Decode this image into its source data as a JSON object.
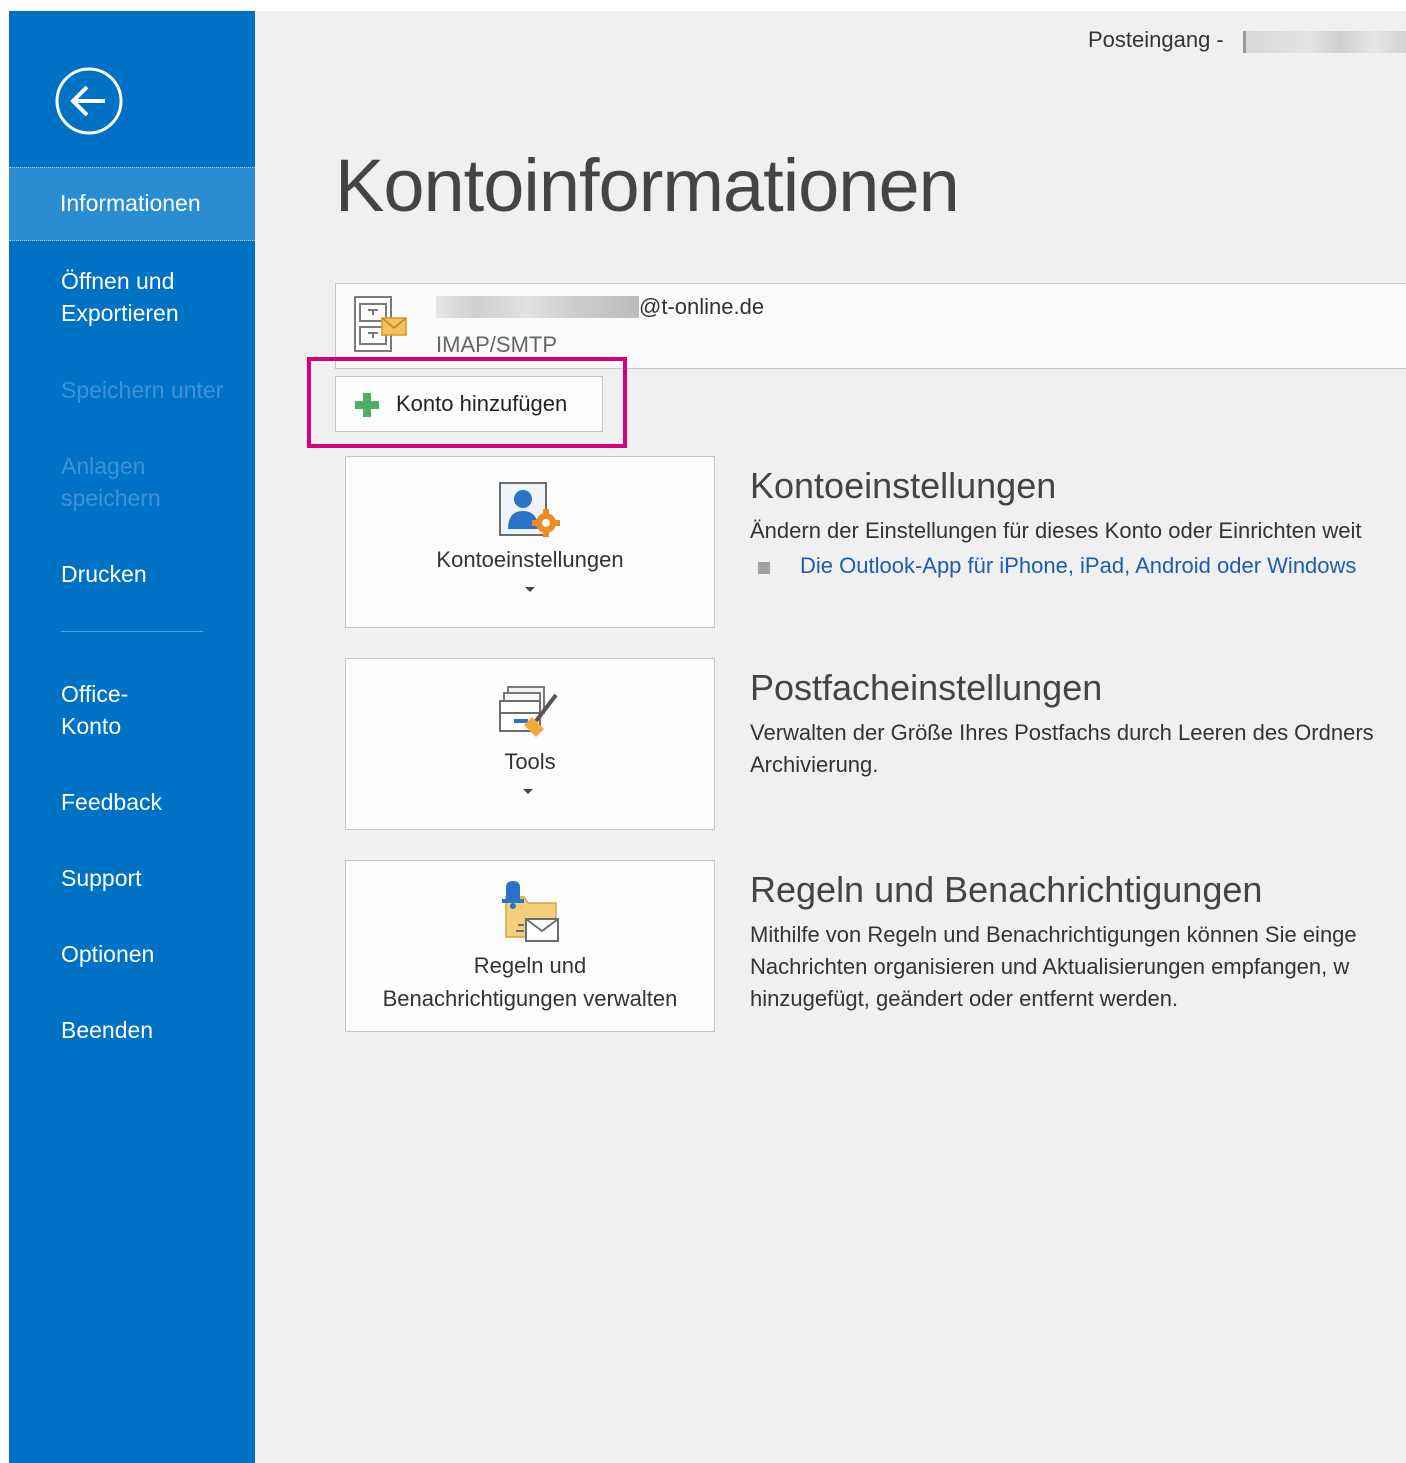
{
  "window": {
    "title": "Posteingang - "
  },
  "sidebar": {
    "items": [
      {
        "label": "Informationen",
        "state": "selected"
      },
      {
        "label": "Öffnen und\nExportieren",
        "state": "enabled"
      },
      {
        "label": "Speichern unter",
        "state": "disabled"
      },
      {
        "label": "Anlagen\nspeichern",
        "state": "disabled"
      },
      {
        "label": "Drucken",
        "state": "enabled"
      },
      {
        "label": "Office-\nKonto",
        "state": "enabled"
      },
      {
        "label": "Feedback",
        "state": "enabled"
      },
      {
        "label": "Support",
        "state": "enabled"
      },
      {
        "label": "Optionen",
        "state": "enabled"
      },
      {
        "label": "Beenden",
        "state": "enabled"
      }
    ]
  },
  "main": {
    "title": "Kontoinformationen",
    "account": {
      "email": "@t-online.de",
      "type": "IMAP/SMTP"
    },
    "add_account_label": "Konto hinzufügen",
    "sections": [
      {
        "button_label": "Kontoeinstellungen",
        "heading": "Kontoeinstellungen",
        "description": "Ändern der Einstellungen für dieses Konto oder Einrichten weit",
        "link": "Die Outlook-App für iPhone, iPad, Android oder Windows"
      },
      {
        "button_label": "Tools",
        "heading": "Postfacheinstellungen",
        "description": "Verwalten der Größe Ihres Postfachs durch Leeren des Ordners\nArchivierung."
      },
      {
        "button_label": "Regeln und\nBenachrichtigungen verwalten",
        "heading": "Regeln und Benachrichtigungen",
        "description": "Mithilfe von Regeln und Benachrichtigungen können Sie einge\nNachrichten organisieren und Aktualisierungen empfangen, w\nhinzugefügt, geändert oder entfernt werden."
      }
    ]
  },
  "colors": {
    "sidebar": "#0072c6",
    "sidebar_selected": "#2a8dd4",
    "content_background": "#f0f0f0",
    "highlight": "#d6007e",
    "link": "#1e5dad"
  },
  "icons": {
    "back": "back-arrow-circle-icon",
    "account": "account-file-cabinet-icon",
    "add": "green-plus-icon",
    "account_settings": "person-gear-icon",
    "tools": "mailbox-broom-icon",
    "rules": "bell-folder-mail-icon"
  }
}
